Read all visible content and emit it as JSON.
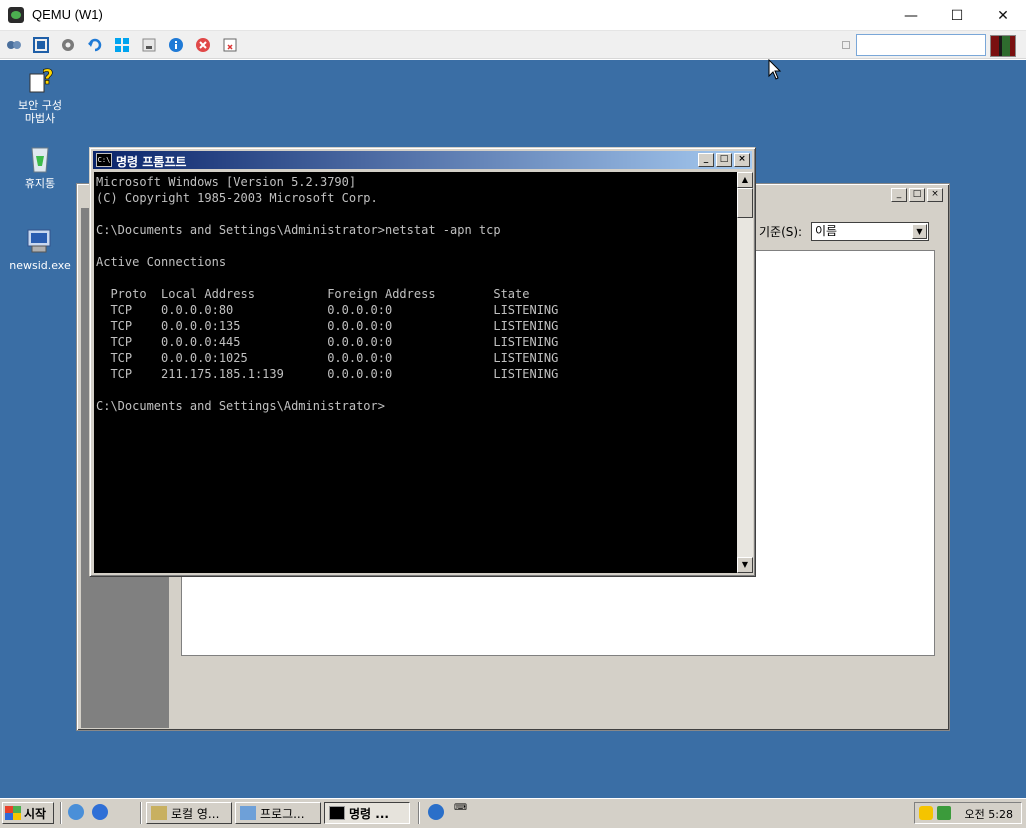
{
  "host": {
    "title": "QEMU (W1)",
    "controls": {
      "minimize": "—",
      "maximize": "☐",
      "close": "✕"
    },
    "toolbar_icons": [
      "drives-icon",
      "fullscreen-icon",
      "settings-icon",
      "refresh-icon",
      "windows-icon",
      "usb-icon",
      "info-icon",
      "stop-icon",
      "snapshot-icon"
    ],
    "toolbar_input": ""
  },
  "desktop": {
    "background": "#3a6ea5",
    "icons": [
      {
        "label": "보안 구성\n마법사"
      },
      {
        "label": "휴지통"
      },
      {
        "label": "newsid.exe"
      }
    ]
  },
  "explorer": {
    "sort_label": "기준(S):",
    "sort_value": "이름"
  },
  "cmd": {
    "title": "명령 프롬프트",
    "icon_text": "C:\\",
    "lines": [
      "Microsoft Windows [Version 5.2.3790]",
      "(C) Copyright 1985-2003 Microsoft Corp.",
      "",
      "C:\\Documents and Settings\\Administrator>netstat -apn tcp",
      "",
      "Active Connections",
      "",
      "  Proto  Local Address          Foreign Address        State",
      "  TCP    0.0.0.0:80             0.0.0.0:0              LISTENING",
      "  TCP    0.0.0.0:135            0.0.0.0:0              LISTENING",
      "  TCP    0.0.0.0:445            0.0.0.0:0              LISTENING",
      "  TCP    0.0.0.0:1025           0.0.0.0:0              LISTENING",
      "  TCP    211.175.185.1:139      0.0.0.0:0              LISTENING",
      "",
      "C:\\Documents and Settings\\Administrator>"
    ]
  },
  "taskbar": {
    "start_label": "시작",
    "tasks": [
      {
        "label": "로컬 영..."
      },
      {
        "label": "프로그..."
      },
      {
        "label": "명령 ..."
      }
    ],
    "clock": "오전 5:28"
  }
}
